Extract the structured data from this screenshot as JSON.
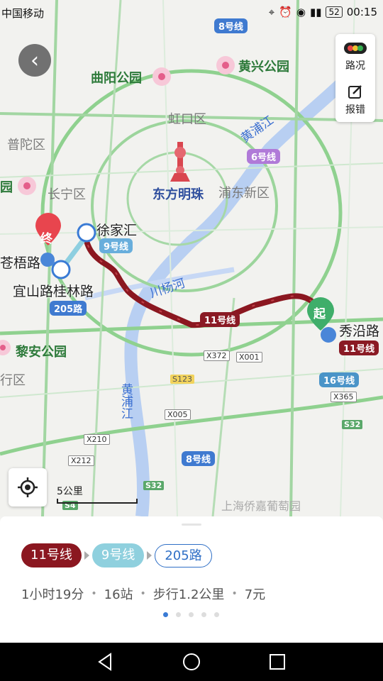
{
  "status": {
    "carrier": "中国移动",
    "battery": "52",
    "time": "00:15"
  },
  "map": {
    "districts": [
      "虹口区",
      "普陀区",
      "长宁区",
      "浦东新区",
      "行区"
    ],
    "parks": [
      "曲阳公园",
      "黄兴公园",
      "园",
      "黎安公园"
    ],
    "landmark": "东方明珠",
    "rivers": [
      "黄浦江",
      "川杨河",
      "黄浦江"
    ],
    "stations": [
      "徐家汇",
      "宜山路桂林路",
      "秀沿路",
      "苍梧路"
    ],
    "line_tags": [
      "8号线",
      "6号线",
      "9号线",
      "205路",
      "11号线",
      "11号线",
      "16号线",
      "8号线"
    ],
    "road_tags": [
      "X372",
      "X001",
      "S123",
      "X005",
      "X210",
      "X212",
      "X365",
      "S32",
      "S32",
      "S4"
    ],
    "start_label": "起",
    "end_label": "终",
    "watermark": "上海侨嘉葡萄园",
    "scale_label": "5公里"
  },
  "controls": {
    "traffic_label": "路况",
    "report_label": "报错"
  },
  "route": {
    "segments": [
      "11号线",
      "9号线",
      "205路"
    ],
    "duration": "1小时19分",
    "stops": "16站",
    "walk": "步行1.2公里",
    "price": "7元",
    "page_count": 5,
    "current_page": 1
  },
  "colors": {
    "route": "#8b1720",
    "accent": "#3a7bd5"
  }
}
